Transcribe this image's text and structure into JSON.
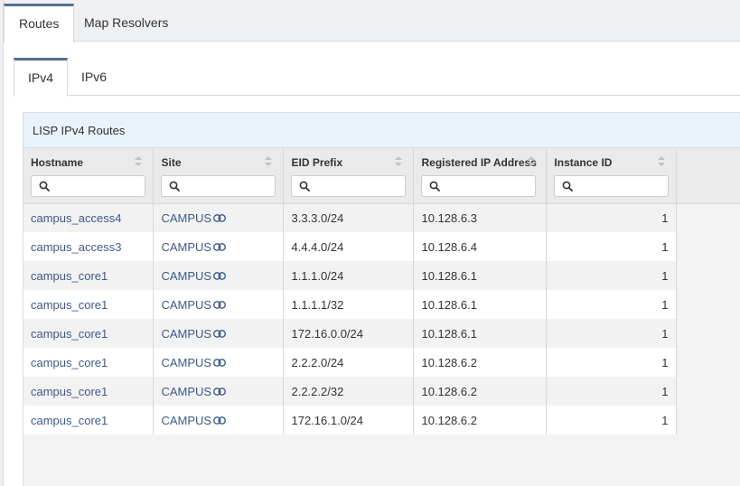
{
  "outer_tabs": [
    {
      "label": "Routes",
      "active": true
    },
    {
      "label": "Map Resolvers",
      "active": false
    }
  ],
  "inner_tabs": [
    {
      "label": "IPv4",
      "active": true
    },
    {
      "label": "IPv6",
      "active": false
    }
  ],
  "panel": {
    "title": "LISP IPv4 Routes"
  },
  "table": {
    "columns": [
      "Hostname",
      "Site",
      "EID Prefix",
      "Registered IP Address",
      "Instance ID"
    ],
    "filter_placeholder": "",
    "rows": [
      {
        "hostname": "campus_access4",
        "site": "CAMPUS",
        "eid_prefix": "3.3.3.0/24",
        "registered_ip": "10.128.6.3",
        "instance_id": "1"
      },
      {
        "hostname": "campus_access3",
        "site": "CAMPUS",
        "eid_prefix": "4.4.4.0/24",
        "registered_ip": "10.128.6.4",
        "instance_id": "1"
      },
      {
        "hostname": "campus_core1",
        "site": "CAMPUS",
        "eid_prefix": "1.1.1.0/24",
        "registered_ip": "10.128.6.1",
        "instance_id": "1"
      },
      {
        "hostname": "campus_core1",
        "site": "CAMPUS",
        "eid_prefix": "1.1.1.1/32",
        "registered_ip": "10.128.6.1",
        "instance_id": "1"
      },
      {
        "hostname": "campus_core1",
        "site": "CAMPUS",
        "eid_prefix": "172.16.0.0/24",
        "registered_ip": "10.128.6.1",
        "instance_id": "1"
      },
      {
        "hostname": "campus_core1",
        "site": "CAMPUS",
        "eid_prefix": "2.2.2.0/24",
        "registered_ip": "10.128.6.2",
        "instance_id": "1"
      },
      {
        "hostname": "campus_core1",
        "site": "CAMPUS",
        "eid_prefix": "2.2.2.2/32",
        "registered_ip": "10.128.6.2",
        "instance_id": "1"
      },
      {
        "hostname": "campus_core1",
        "site": "CAMPUS",
        "eid_prefix": "172.16.1.0/24",
        "registered_ip": "10.128.6.2",
        "instance_id": "1"
      }
    ]
  },
  "icons": {
    "filter": "search-icon",
    "site_link": "link-icon",
    "sort": "sort-icon"
  },
  "colors": {
    "link": "#3c5a8e",
    "tab_accent": "#586e8c",
    "panel_header": "#e8f2fb"
  }
}
